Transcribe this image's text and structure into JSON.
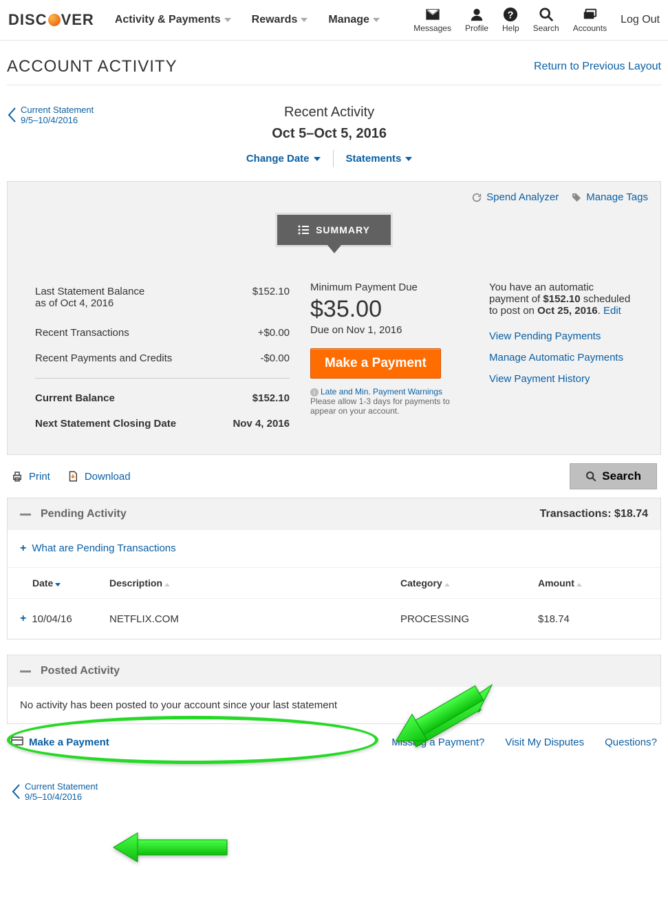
{
  "nav": {
    "brand_pre": "DISC",
    "brand_post": "VER",
    "items": [
      "Activity & Payments",
      "Rewards",
      "Manage"
    ],
    "right": {
      "messages": "Messages",
      "profile": "Profile",
      "help": "Help",
      "search": "Search",
      "accounts": "Accounts",
      "logout": "Log Out"
    }
  },
  "page": {
    "title": "ACCOUNT ACTIVITY",
    "return_link": "Return to Previous Layout",
    "stmt_link_label": "Current Statement",
    "stmt_link_range": "9/5–10/4/2016",
    "recent_activity": "Recent Activity",
    "date_range": "Oct 5–Oct 5, 2016",
    "change_date": "Change Date",
    "statements": "Statements"
  },
  "summary": {
    "spend_analyzer": "Spend Analyzer",
    "manage_tags": "Manage Tags",
    "tab": "SUMMARY",
    "last_stmt_label": "Last Statement Balance",
    "last_stmt_as_of": "as of Oct 4, 2016",
    "last_stmt_value": "$152.10",
    "recent_tx_label": "Recent Transactions",
    "recent_tx_value": "+$0.00",
    "recent_pay_label": "Recent Payments and Credits",
    "recent_pay_value": "-$0.00",
    "current_bal_label": "Current Balance",
    "current_bal_value": "$152.10",
    "next_close_label": "Next Statement Closing Date",
    "next_close_value": "Nov 4, 2016",
    "min_due_label": "Minimum Payment Due",
    "min_due_value": "$35.00",
    "due_on": "Due on Nov 1, 2016",
    "make_payment": "Make a Payment",
    "warn_link": "Late and Min. Payment Warnings",
    "warn_text": "Please allow 1-3 days for payments to appear on your account.",
    "auto_pre": "You have an automatic payment of ",
    "auto_amount": "$152.10",
    "auto_mid": " scheduled to post on ",
    "auto_date": "Oct 25, 2016",
    "auto_post": ". ",
    "edit": "Edit",
    "view_pending": "View Pending Payments",
    "manage_auto": "Manage Automatic Payments",
    "view_history": "View Payment History"
  },
  "toolbar": {
    "print": "Print",
    "download": "Download",
    "search": "Search"
  },
  "pending": {
    "title": "Pending Activity",
    "tx_label": "Transactions: $18.74",
    "what_link": "What are Pending Transactions",
    "cols": {
      "date": "Date",
      "desc": "Description",
      "cat": "Category",
      "amt": "Amount"
    },
    "row": {
      "date": "10/04/16",
      "desc": "NETFLIX.COM",
      "cat": "PROCESSING",
      "amt": "$18.74"
    }
  },
  "posted": {
    "title": "Posted Activity",
    "empty": "No activity has been posted to your account since your last statement"
  },
  "footer": {
    "make_payment": "Make a Payment",
    "missing": "Missing a Payment?",
    "disputes": "Visit My Disputes",
    "questions": "Questions?",
    "stmt_link_label": "Current Statement",
    "stmt_link_range": "9/5–10/4/2016"
  }
}
